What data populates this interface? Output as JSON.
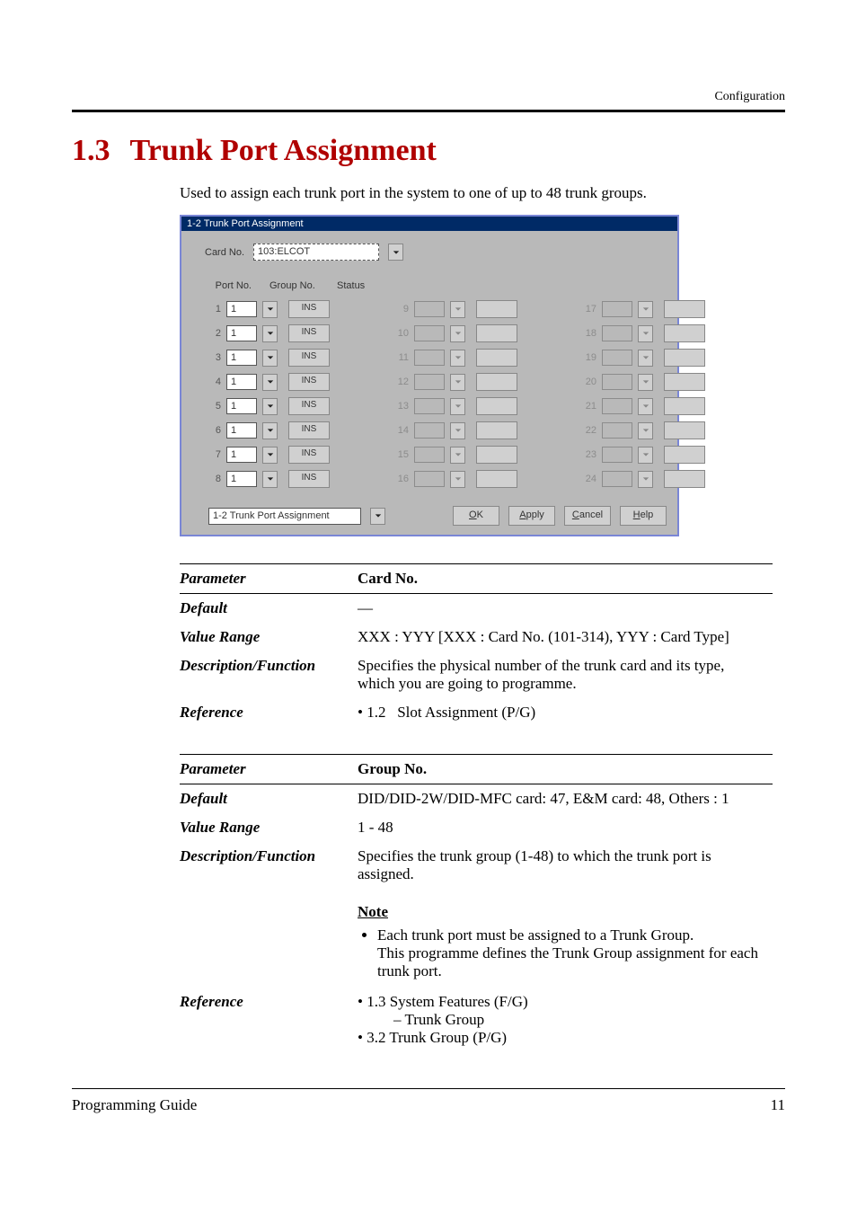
{
  "header": {
    "category": "Configuration"
  },
  "heading": {
    "number": "1.3",
    "title": "Trunk Port Assignment"
  },
  "lead": "Used to assign each trunk port in the system to one of up to 48 trunk groups.",
  "shot": {
    "titlebar": "1-2 Trunk Port Assignment",
    "card_label": "Card No.",
    "card_value": "103:ELCOT",
    "head_port": "Port No.",
    "head_group": "Group No.",
    "head_status": "Status",
    "status_label": "INS",
    "col_a": [
      {
        "n": "1",
        "v": "1"
      },
      {
        "n": "2",
        "v": "1"
      },
      {
        "n": "3",
        "v": "1"
      },
      {
        "n": "4",
        "v": "1"
      },
      {
        "n": "5",
        "v": "1"
      },
      {
        "n": "6",
        "v": "1"
      },
      {
        "n": "7",
        "v": "1"
      },
      {
        "n": "8",
        "v": "1"
      }
    ],
    "col_b": [
      {
        "n": "9"
      },
      {
        "n": "10"
      },
      {
        "n": "11"
      },
      {
        "n": "12"
      },
      {
        "n": "13"
      },
      {
        "n": "14"
      },
      {
        "n": "15"
      },
      {
        "n": "16"
      }
    ],
    "col_c": [
      {
        "n": "17"
      },
      {
        "n": "18"
      },
      {
        "n": "19"
      },
      {
        "n": "20"
      },
      {
        "n": "21"
      },
      {
        "n": "22"
      },
      {
        "n": "23"
      },
      {
        "n": "24"
      }
    ],
    "nav_value": "1-2 Trunk Port Assignment",
    "btn_ok": "OK",
    "btn_apply": "Apply",
    "btn_cancel": "Cancel",
    "btn_help": "Help"
  },
  "t1": {
    "parameter_label": "Parameter",
    "parameter_value": "Card No.",
    "default_label": "Default",
    "default_value": "—",
    "range_label": "Value Range",
    "range_value": "XXX : YYY [XXX : Card No. (101-314), YYY : Card Type]",
    "desc_label": "Description/Function",
    "desc_value": "Specifies the physical number of the trunk card and its type, which you are going to programme.",
    "ref_label": "Reference",
    "ref_bullet": "1.2",
    "ref_text": "Slot Assignment (P/G)"
  },
  "t2": {
    "parameter_label": "Parameter",
    "parameter_value": "Group No.",
    "default_label": "Default",
    "default_value": "DID/DID-2W/DID-MFC card: 47, E&M card: 48, Others : 1",
    "range_label": "Value Range",
    "range_value": "1 - 48",
    "desc_label": "Description/Function",
    "desc_value": "Specifies the trunk group (1-48) to which the trunk port is assigned.",
    "note_title": "Note",
    "note_line1": "Each trunk port must be assigned to a Trunk Group.",
    "note_line2": "This programme defines the Trunk Group assignment for each trunk port.",
    "ref_label": "Reference",
    "ref_b1": "1.3 System Features (F/G)",
    "ref_b1_sub": "– Trunk Group",
    "ref_b2": "3.2 Trunk Group (P/G)"
  },
  "footer": {
    "left": "Programming Guide",
    "right": "11"
  }
}
